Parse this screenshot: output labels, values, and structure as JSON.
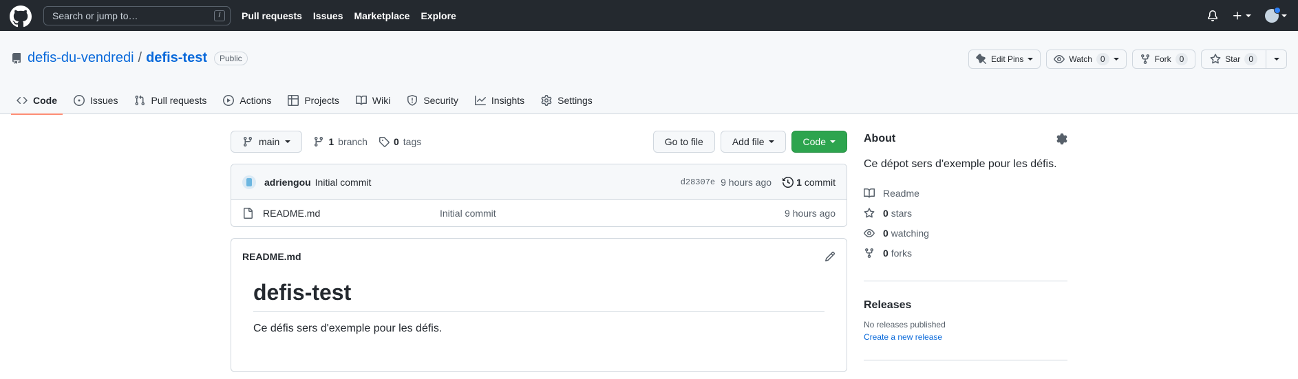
{
  "topbar": {
    "search_placeholder": "Search or jump to…",
    "search_shortcut": "/",
    "nav": [
      "Pull requests",
      "Issues",
      "Marketplace",
      "Explore"
    ]
  },
  "repo": {
    "owner": "defis-du-vendredi",
    "separator": "/",
    "name": "defis-test",
    "visibility": "Public",
    "actions": {
      "edit_pins": "Edit Pins",
      "watch": "Watch",
      "watch_count": "0",
      "fork": "Fork",
      "fork_count": "0",
      "star": "Star",
      "star_count": "0"
    },
    "tabs": [
      {
        "label": "Code",
        "icon": "code-icon",
        "active": true
      },
      {
        "label": "Issues",
        "icon": "issue-icon"
      },
      {
        "label": "Pull requests",
        "icon": "pull-request-icon"
      },
      {
        "label": "Actions",
        "icon": "play-icon"
      },
      {
        "label": "Projects",
        "icon": "table-icon"
      },
      {
        "label": "Wiki",
        "icon": "book-icon"
      },
      {
        "label": "Security",
        "icon": "shield-icon"
      },
      {
        "label": "Insights",
        "icon": "graph-icon"
      },
      {
        "label": "Settings",
        "icon": "gear-icon"
      }
    ]
  },
  "filebar": {
    "branch": "main",
    "branch_count": "1",
    "branch_label": "branch",
    "tag_count": "0",
    "tag_label": "tags",
    "go_to_file": "Go to file",
    "add_file": "Add file",
    "code": "Code"
  },
  "commit": {
    "author": "adriengou",
    "message": "Initial commit",
    "sha": "d28307e",
    "age": "9 hours ago",
    "count": "1",
    "count_label": "commit"
  },
  "files": [
    {
      "name": "README.md",
      "message": "Initial commit",
      "age": "9 hours ago"
    }
  ],
  "readme": {
    "filename": "README.md",
    "heading": "defis-test",
    "text": "Ce défis sers d'exemple pour les défis."
  },
  "about": {
    "title": "About",
    "description": "Ce dépot sers d'exemple pour les défis.",
    "readme": "Readme",
    "stars_count": "0",
    "stars_label": "stars",
    "watching_count": "0",
    "watching_label": "watching",
    "forks_count": "0",
    "forks_label": "forks"
  },
  "releases": {
    "title": "Releases",
    "none": "No releases published",
    "create": "Create a new release"
  },
  "colors": {
    "header_bg": "#24292f",
    "link": "#0969da",
    "green": "#2da44e",
    "tab_underline": "#fd8c73"
  }
}
